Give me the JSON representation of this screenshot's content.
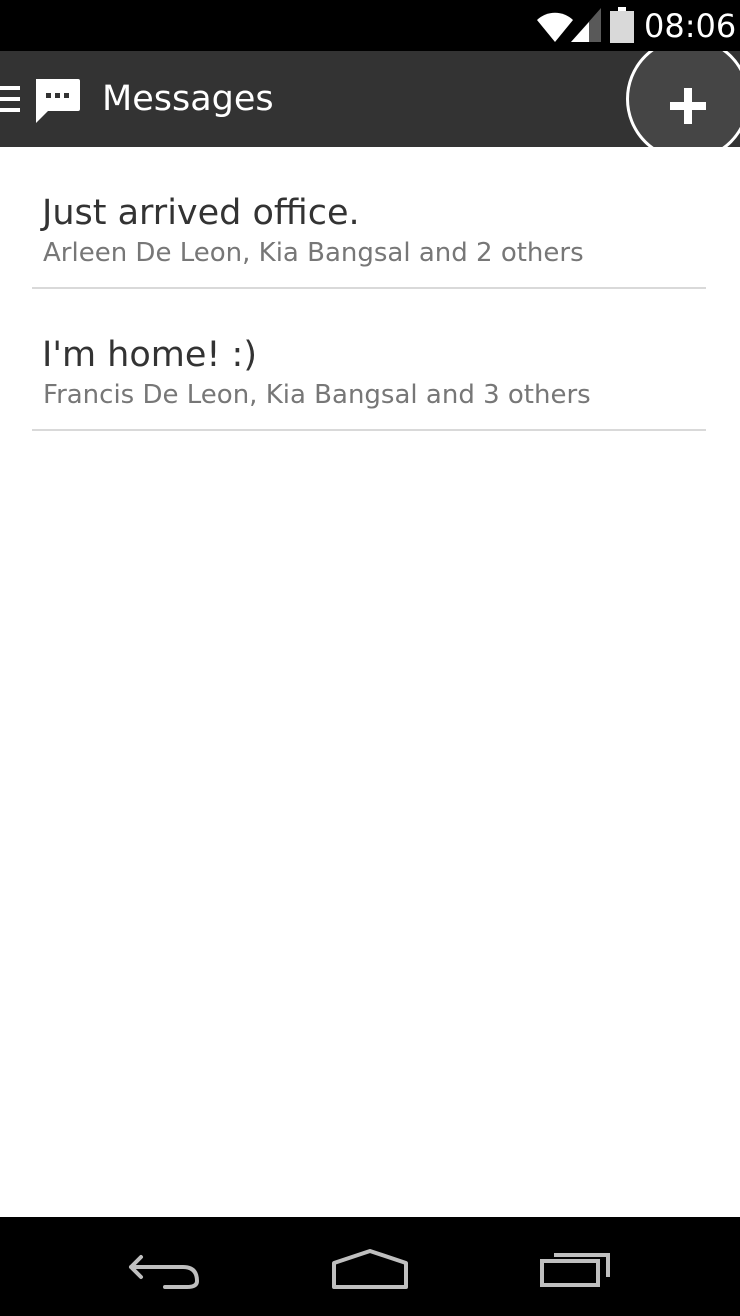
{
  "status_bar": {
    "time": "08:06",
    "icons": [
      "wifi-icon",
      "cell-signal-icon",
      "battery-icon"
    ]
  },
  "action_bar": {
    "drawer_icon": "menu-icon",
    "app_icon": "message-bubble-icon",
    "title": "Messages",
    "new_button_icon": "plus-icon"
  },
  "conversations": [
    {
      "subject": "Just arrived office.",
      "participants": "Arleen De Leon, Kia Bangsal and 2 others"
    },
    {
      "subject": "I'm home! :)",
      "participants": "Francis De Leon, Kia Bangsal and 3 others"
    }
  ],
  "nav_bar": {
    "buttons": [
      "back-icon",
      "home-icon",
      "recents-icon"
    ]
  },
  "colors": {
    "status_bar": "#000000",
    "action_bar": "#333333",
    "background": "#ffffff",
    "subject_text": "#333333",
    "participants_text": "#777777",
    "divider": "#d9d9d9"
  }
}
